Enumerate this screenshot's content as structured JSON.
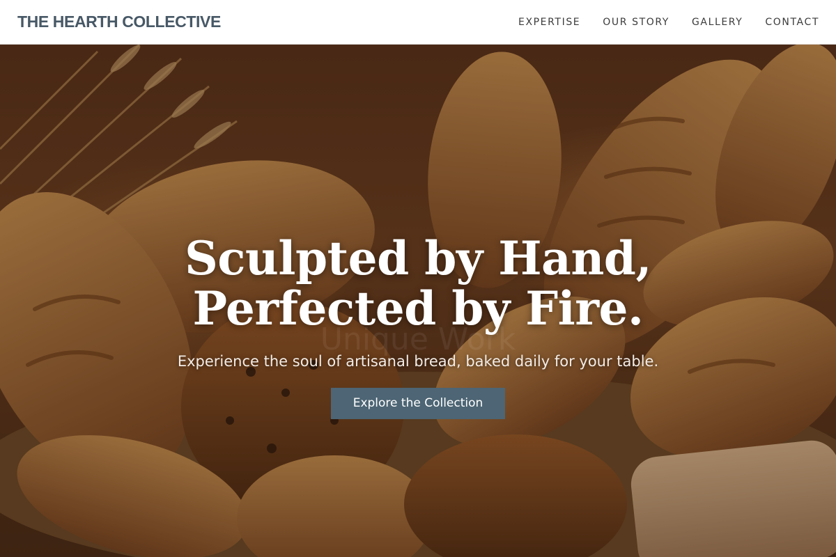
{
  "header": {
    "brand": "THE HEARTH COLLECTIVE",
    "nav": [
      {
        "label": "EXPERTISE"
      },
      {
        "label": "OUR STORY"
      },
      {
        "label": "GALLERY"
      },
      {
        "label": "CONTACT"
      }
    ]
  },
  "hero": {
    "title_line1": "Sculpted by Hand,",
    "title_line2": "Perfected by Fire.",
    "subtitle": "Experience the soul of artisanal bread, baked daily for your table.",
    "cta_label": "Explore the Collection",
    "image_alt": "artisan breads in a wicker basket with wheat stalks",
    "watermark": "Unique Work"
  },
  "colors": {
    "brand": "#475866",
    "button": "#4d6574",
    "header_bg": "#ffffff"
  }
}
